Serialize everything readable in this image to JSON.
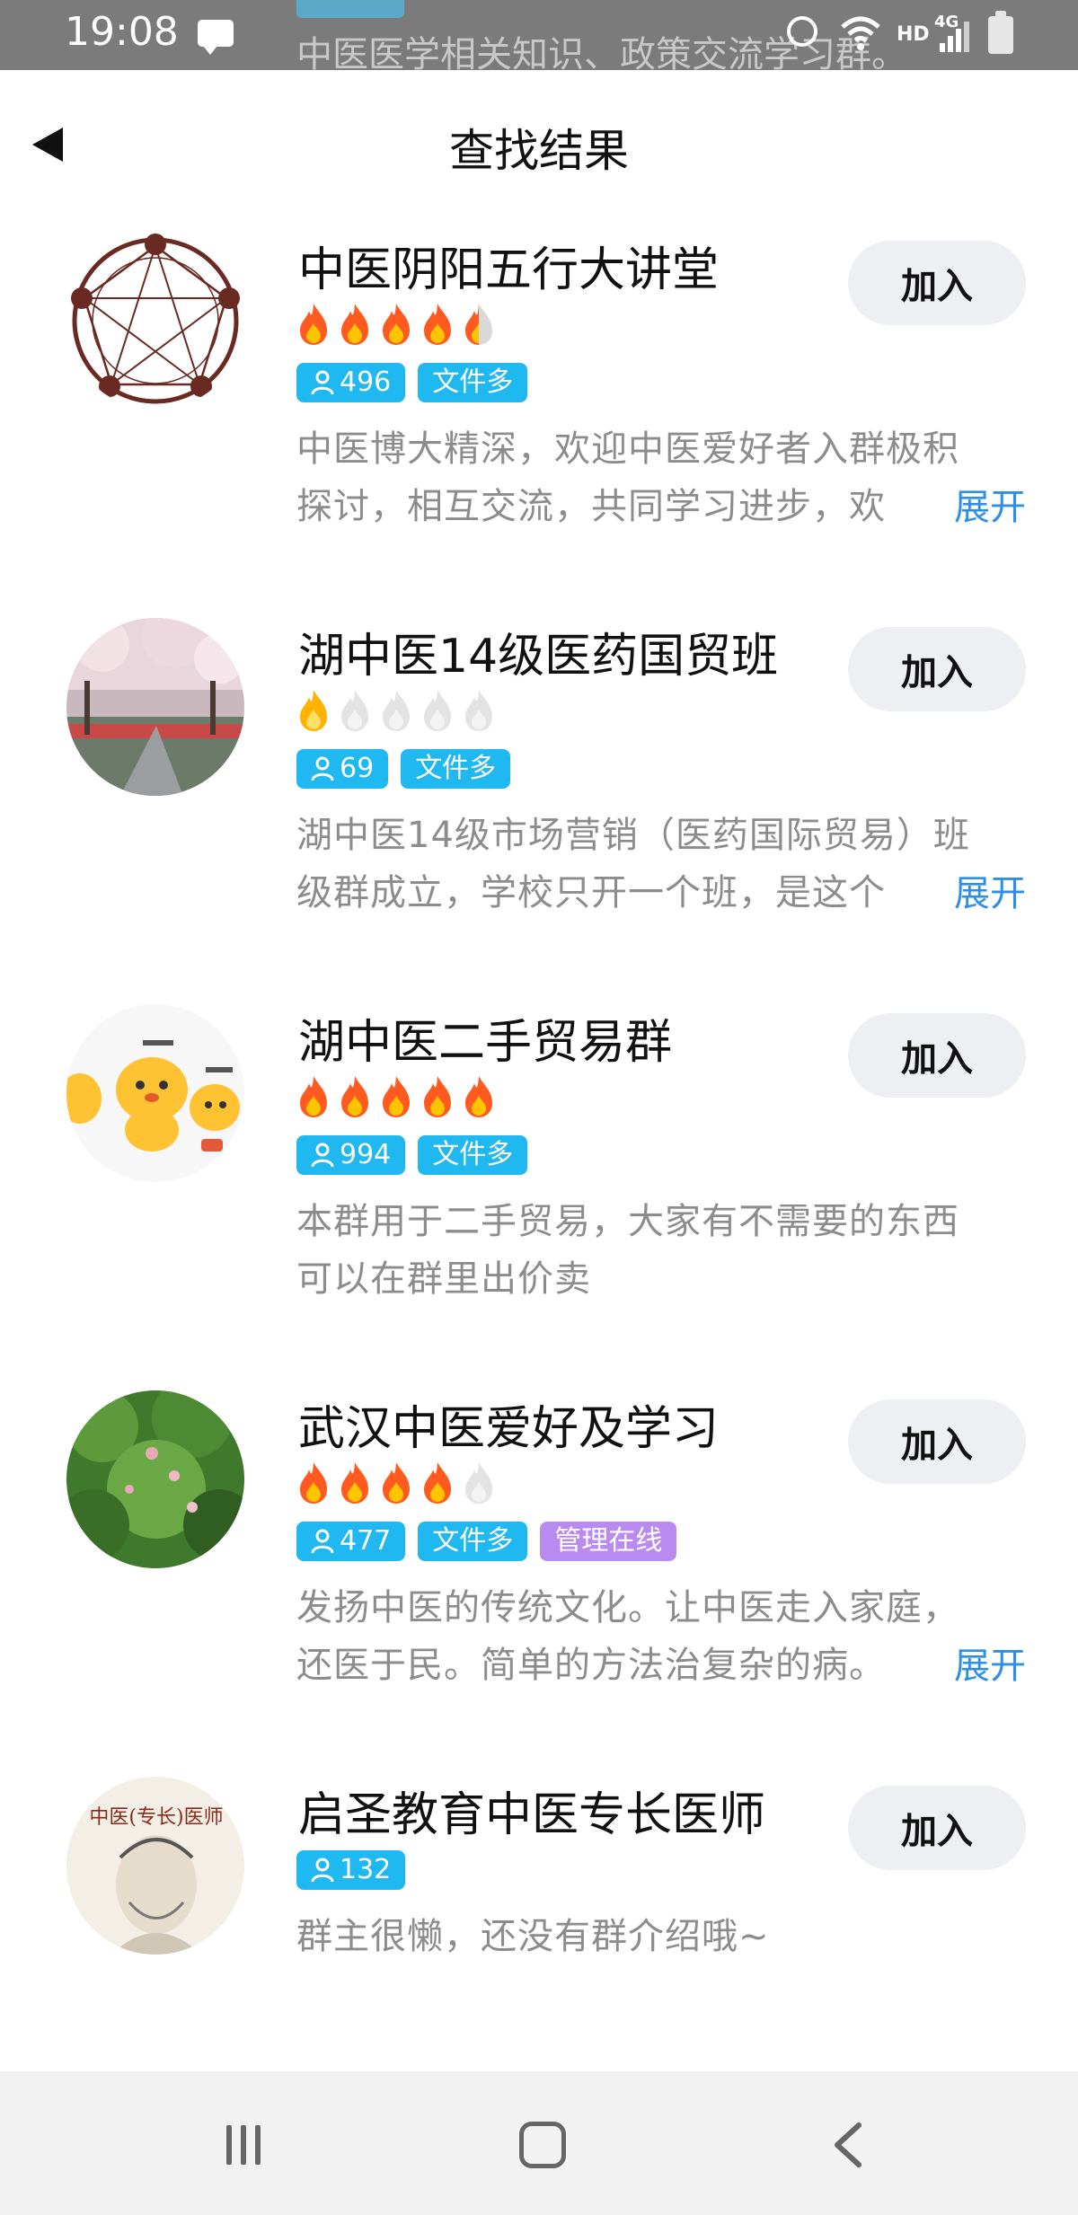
{
  "status_bar": {
    "time": "19:08",
    "network_label": "HD",
    "network_gen": "4G",
    "behind_text": "中医医学相关知识、政策交流学习群。",
    "icons": [
      "chat-icon",
      "alarm-icon",
      "wifi-icon",
      "signal-icon",
      "battery-icon"
    ]
  },
  "header": {
    "title": "查找结果",
    "back_icon": "back-triangle-icon"
  },
  "colors": {
    "tag_blue": "#20b8f0",
    "tag_purple": "#b98af0",
    "link_blue": "#2e8fe8",
    "flame_active": "#ff5a1f",
    "flame_inactive": "#d9d9d9",
    "join_button_bg": "#eeeff3",
    "nav_bg": "#f2f2f2"
  },
  "results": [
    {
      "name": "中医阴阳五行大讲堂",
      "join_label": "加入",
      "heat_rating": 4.5,
      "members": "496",
      "tags": [
        "文件多"
      ],
      "description_line1": "中医博大精深，欢迎中医爱好者入群极积",
      "description_line2": "探讨，相互交流，共同学习进步，欢",
      "expand_label": "展开",
      "avatar": "five-elements-diagram"
    },
    {
      "name": "湖中医14级医药国贸班",
      "join_label": "加入",
      "heat_rating": 1,
      "members": "69",
      "tags": [
        "文件多"
      ],
      "description_line1": "湖中医14级市场营销（医药国际贸易）班",
      "description_line2": "级群成立，学校只开一个班，是这个",
      "expand_label": "展开",
      "avatar": "cherry-blossom-photo"
    },
    {
      "name": "湖中医二手贸易群",
      "join_label": "加入",
      "heat_rating": 5,
      "members": "994",
      "tags": [
        "文件多"
      ],
      "description_line1": "本群用于二手贸易，大家有不需要的东西",
      "description_line2": "可以在群里出价卖",
      "expand_label": "",
      "avatar": "cartoon-characters"
    },
    {
      "name": "武汉中医爱好及学习",
      "join_label": "加入",
      "heat_rating": 4,
      "members": "477",
      "tags": [
        "文件多",
        "管理在线"
      ],
      "description_line1": "发扬中医的传统文化。让中医走入家庭，",
      "description_line2": "还医于民。简单的方法治复杂的病。",
      "expand_label": "展开",
      "avatar": "flowering-shrub-photo"
    },
    {
      "name": "启圣教育中医专长医师",
      "join_label": "加入",
      "heat_rating": null,
      "members": "132",
      "tags": [],
      "description_line1": "群主很懒，还没有群介绍哦~",
      "description_line2": "",
      "expand_label": "",
      "avatar": "elder-doctor-illustration",
      "avatar_text": "中医(专长)医师"
    }
  ],
  "nav_bar": {
    "buttons": [
      "recent-apps-icon",
      "home-icon",
      "back-chevron-icon"
    ]
  }
}
